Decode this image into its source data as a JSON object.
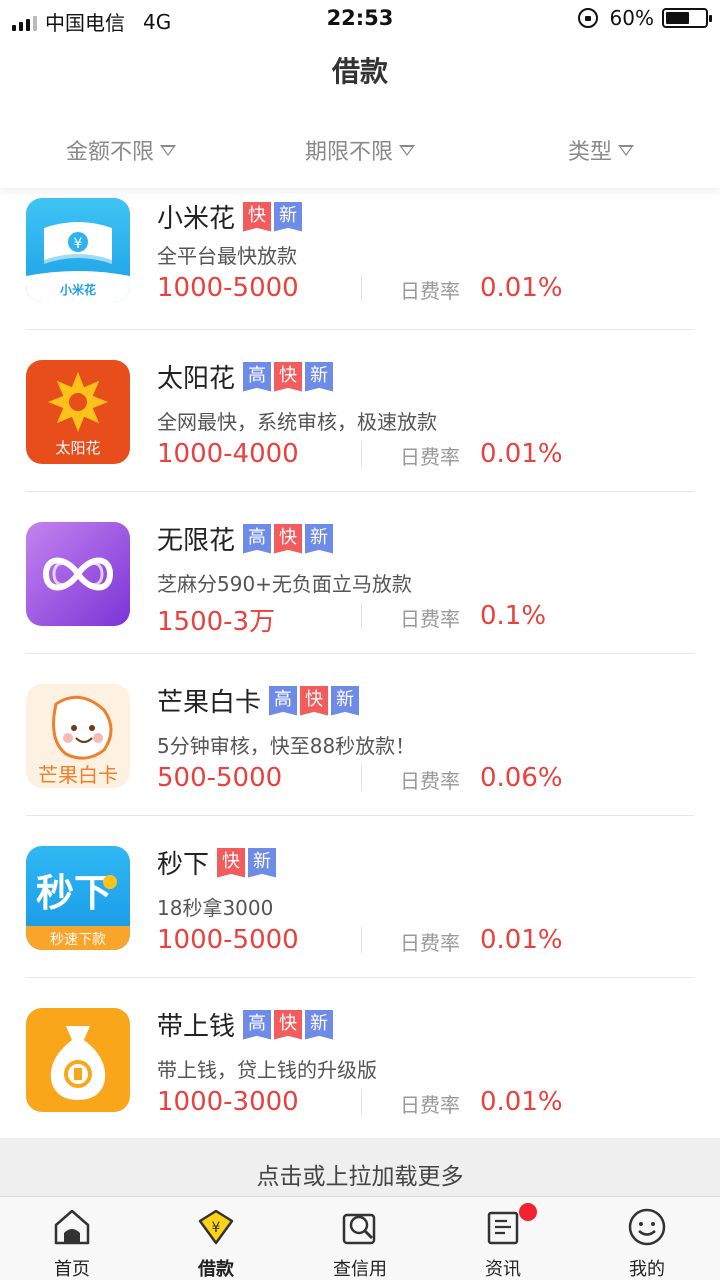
{
  "status": {
    "carrier": "中国电信",
    "network": "4G",
    "time": "22:53",
    "battery": "60%",
    "battery_level": 0.6
  },
  "header": {
    "title": "借款"
  },
  "filters": [
    {
      "label": "金额不限"
    },
    {
      "label": "期限不限"
    },
    {
      "label": "类型"
    }
  ],
  "rate_label": "日费率",
  "colors": {
    "accent": "#e8413e",
    "tag_blue": "#6f8be8",
    "tag_red": "#f25c5c"
  },
  "products": [
    {
      "name": "小米花",
      "tags": [
        "快",
        "新"
      ],
      "desc": "全平台最快放款",
      "amount": "1000-5000",
      "rate": "0.01%",
      "logo_text": "小米花",
      "logo_icon": "money-bills-icon"
    },
    {
      "name": "太阳花",
      "tags": [
        "高",
        "快",
        "新"
      ],
      "desc": "全网最快，系统审核，极速放款",
      "amount": "1000-4000",
      "rate": "0.01%",
      "logo_text": "太阳花",
      "logo_icon": "sun-flower-icon"
    },
    {
      "name": "无限花",
      "tags": [
        "高",
        "快",
        "新"
      ],
      "desc": "芝麻分590+无负面立马放款",
      "amount": "1500-3万",
      "rate": "0.1%",
      "logo_text": "",
      "logo_icon": "infinity-icon"
    },
    {
      "name": "芒果白卡",
      "tags": [
        "高",
        "快",
        "新"
      ],
      "desc": "5分钟审核，快至88秒放款！",
      "amount": "500-5000",
      "rate": "0.06%",
      "logo_text": "芒果白卡",
      "logo_icon": "mango-face-icon"
    },
    {
      "name": "秒下",
      "tags": [
        "快",
        "新"
      ],
      "desc": "18秒拿3000",
      "amount": "1000-5000",
      "rate": "0.01%",
      "logo_text": "秒下",
      "logo_subtext": "秒速下款",
      "logo_icon": "coin-icon"
    },
    {
      "name": "带上钱",
      "tags": [
        "高",
        "快",
        "新"
      ],
      "desc": "带上钱，贷上钱的升级版",
      "amount": "1000-3000",
      "rate": "0.01%",
      "logo_text": "",
      "logo_icon": "money-bag-icon"
    }
  ],
  "load_more": "点击或上拉加载更多",
  "tabs": [
    {
      "label": "首页",
      "icon": "home-icon"
    },
    {
      "label": "借款",
      "icon": "yen-tag-icon",
      "active": true
    },
    {
      "label": "查信用",
      "icon": "credit-search-icon"
    },
    {
      "label": "资讯",
      "icon": "news-icon",
      "badge": true
    },
    {
      "label": "我的",
      "icon": "smile-profile-icon"
    }
  ]
}
